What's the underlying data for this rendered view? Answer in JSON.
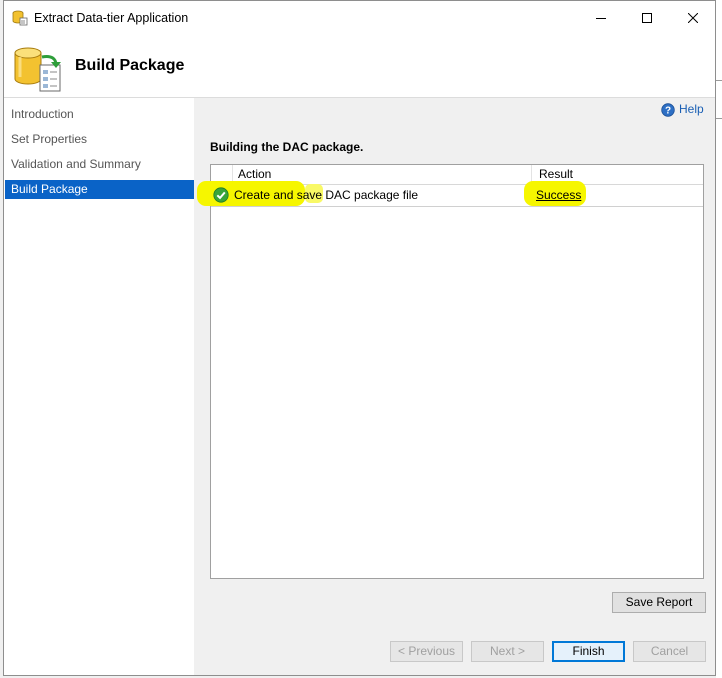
{
  "window": {
    "title": "Extract Data-tier Application"
  },
  "header": {
    "title": "Build Package"
  },
  "nav": {
    "items": [
      {
        "label": "Introduction"
      },
      {
        "label": "Set Properties"
      },
      {
        "label": "Validation and Summary"
      },
      {
        "label": "Build Package",
        "selected": true
      }
    ]
  },
  "content": {
    "help_label": "Help",
    "heading": "Building the DAC package.",
    "table": {
      "columns": [
        "",
        "Action",
        "Result"
      ],
      "rows": [
        {
          "status_icon": "success-check-icon",
          "action": "Create and save DAC package file",
          "result": "Success"
        }
      ]
    },
    "save_report_label": "Save Report"
  },
  "footer": {
    "previous_label": "< Previous",
    "next_label": "Next >",
    "finish_label": "Finish",
    "cancel_label": "Cancel"
  },
  "colors": {
    "selection": "#0a63c7",
    "highlight": "#f6f600",
    "success": "#3aa53a",
    "link": "#1a5fb4"
  }
}
